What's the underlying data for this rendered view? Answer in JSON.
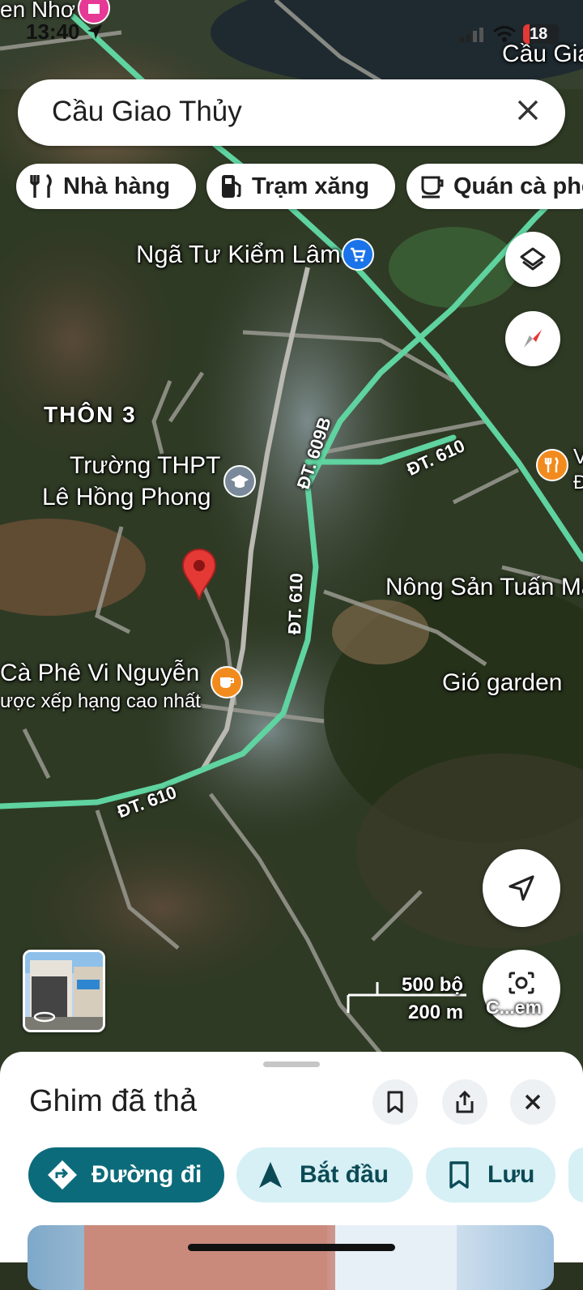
{
  "status_bar": {
    "time": "13:40",
    "battery": "18"
  },
  "search": {
    "query": "Cầu Giao Thủy"
  },
  "chips": [
    {
      "label": "Nhà hàng",
      "icon": "fork-knife-icon"
    },
    {
      "label": "Trạm xăng",
      "icon": "gas-station-icon"
    },
    {
      "label": "Quán cà phê",
      "icon": "coffee-cup-icon"
    }
  ],
  "map": {
    "labels": {
      "top_left": "en Nhơ",
      "top_right": "Cầu Gia",
      "intersection": "Ngã Tư Kiểm Lâm",
      "village": "THÔN 3",
      "school_line1": "Trường THPT",
      "school_line2": "Lê Hồng Phong",
      "farm": "Nông Sản Tuấn Ma",
      "cafe_line1": "Cà Phê Vi Nguyễn",
      "cafe_line2": "ược xếp hạng cao nhất",
      "garden": "Gió garden",
      "edge_right_1": "V",
      "edge_right_2": "Đ"
    },
    "roads": {
      "r609b": "ĐT. 609B",
      "r610_east": "ĐT. 610",
      "r610_vertical": "ĐT. 610",
      "r610_south": "ĐT. 610"
    },
    "scale": {
      "imperial": "500 bộ",
      "metric": "200 m"
    },
    "camera_label": "C...em"
  },
  "sheet": {
    "title": "Ghim đã thả",
    "buttons": {
      "directions": "Đường đi",
      "start": "Bắt đầu",
      "save": "Lưu"
    }
  },
  "colors": {
    "road": "#5fd3a0",
    "pin": "#e53935",
    "directions_bg": "#0b6b7a",
    "pill_bg": "#d6f0f5",
    "poi_orange": "#f28b1e",
    "poi_blue": "#1a73e8"
  }
}
